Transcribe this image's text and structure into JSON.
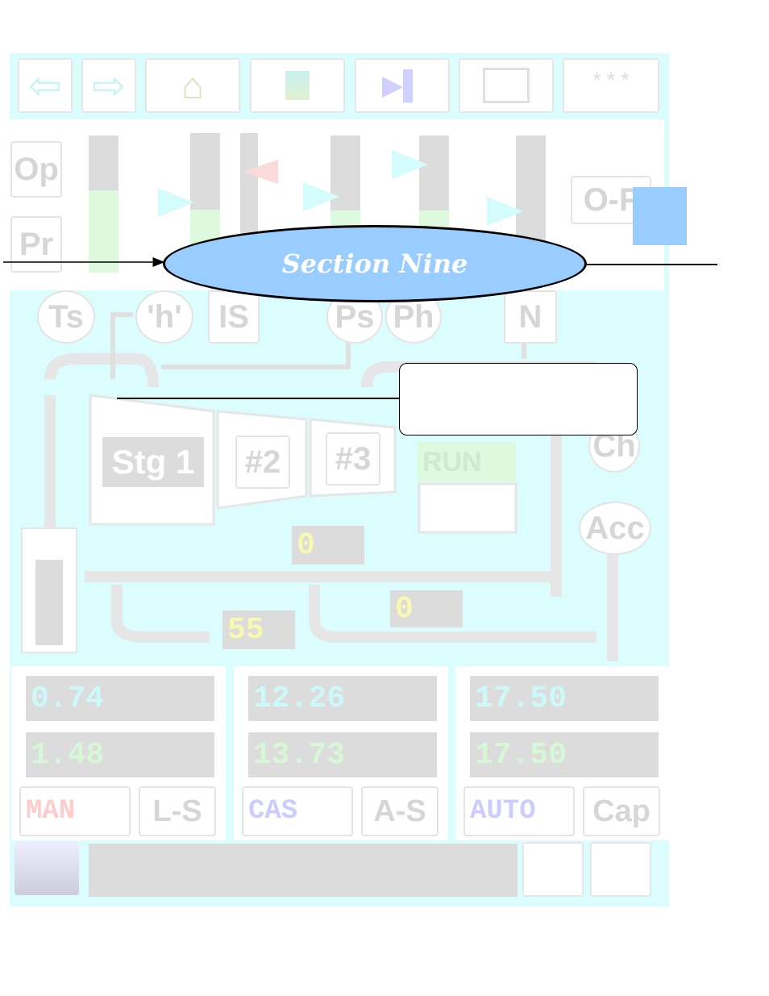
{
  "toolbar": {
    "buttons": [
      {
        "name": "back",
        "icon": "arrow-left-icon"
      },
      {
        "name": "forward",
        "icon": "arrow-right-icon"
      },
      {
        "name": "home",
        "icon": "home-icon"
      },
      {
        "name": "plant",
        "icon": "plant-icon"
      },
      {
        "name": "trend",
        "icon": "trend-icon"
      },
      {
        "name": "graph",
        "icon": "graph-icon"
      },
      {
        "name": "more",
        "label": "* * *"
      }
    ]
  },
  "side": {
    "op": "Op",
    "pr": "Pr",
    "op_f": "O-F"
  },
  "bars": [
    60,
    45,
    0,
    45,
    45,
    20
  ],
  "overlay": {
    "title": "Section Nine",
    "title_color": "#99ccff",
    "callout_text": ""
  },
  "diagram": {
    "ts": "Ts",
    "h": "'h'",
    "is": "IS",
    "ps": "Ps",
    "ph": "Ph",
    "n": "N",
    "stg1": "Stg 1",
    "stg2": "#2",
    "stg3": "#3",
    "run": "RUN",
    "ch": "Ch",
    "acc": "Acc",
    "val_a": "0",
    "val_b": "0",
    "val_c": "55"
  },
  "panels": [
    {
      "v1": "0.74",
      "v2": "1.48",
      "mode": "MAN",
      "mode_color": "#ffcccc",
      "b2": "L-S"
    },
    {
      "v1": "12.26",
      "v2": "13.73",
      "mode": "CAS",
      "mode_color": "#ccccff",
      "b2": "A-S"
    },
    {
      "v1": "17.50",
      "v2": "17.50",
      "mode": "AUTO",
      "mode_color": "#ccccff",
      "b2": "Cap"
    }
  ],
  "status": {
    "message": "",
    "icon": "printer-icon"
  }
}
